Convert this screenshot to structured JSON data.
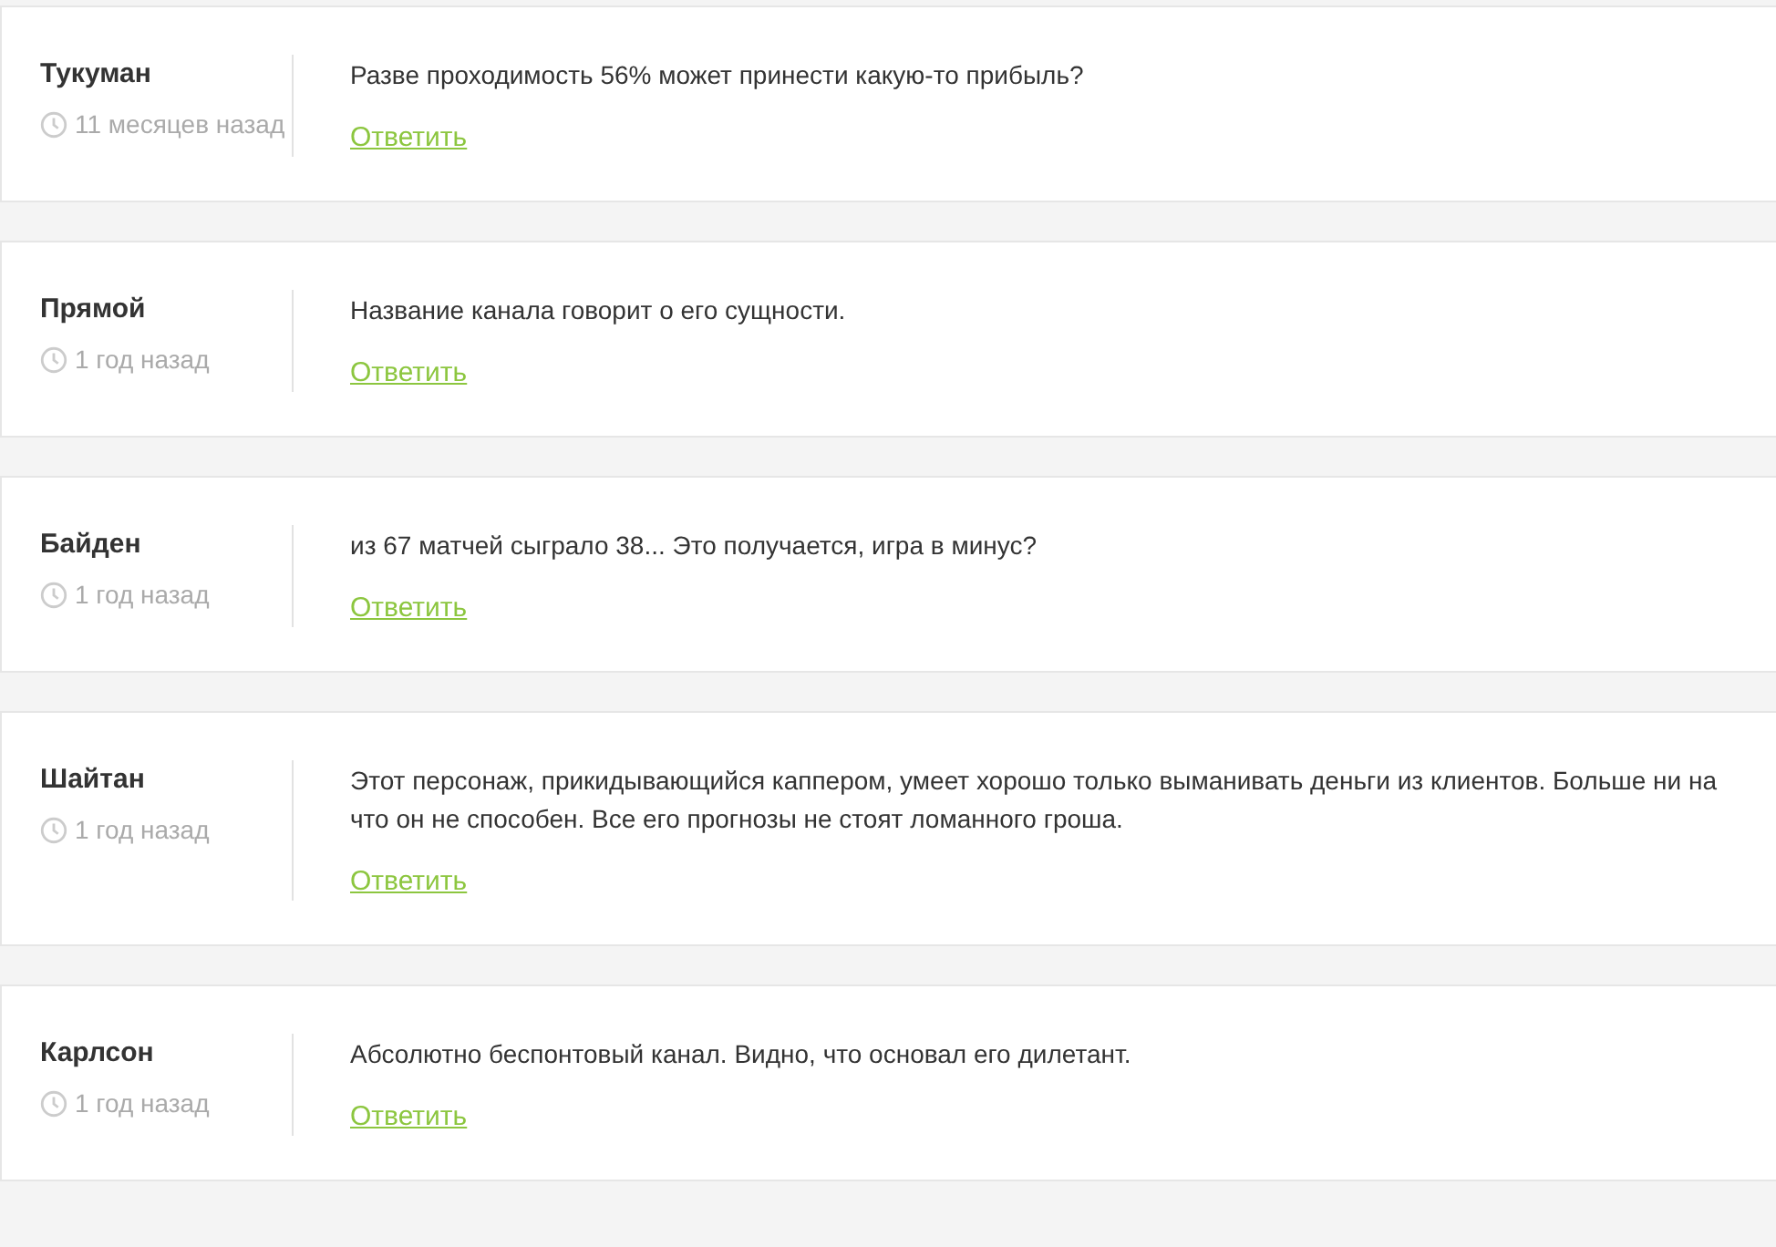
{
  "comments": [
    {
      "author": "Тукуман",
      "time": "11 месяцев назад",
      "text": "Разве проходимость 56% может принести какую-то прибыль?",
      "reply": "Ответить"
    },
    {
      "author": "Прямой",
      "time": "1 год назад",
      "text": "Название канала говорит о его сущности.",
      "reply": "Ответить"
    },
    {
      "author": "Байден",
      "time": "1 год назад",
      "text": "из 67 матчей сыграло 38... Это получается, игра в минус?",
      "reply": "Ответить"
    },
    {
      "author": "Шайтан",
      "time": "1 год назад",
      "text": "Этот персонаж, прикидывающийся каппером, умеет хорошо только выманивать деньги из клиентов. Больше ни на что он не способен. Все его прогнозы не стоят ломанного гроша.",
      "reply": "Ответить"
    },
    {
      "author": "Карлсон",
      "time": "1 год назад",
      "text": "Абсолютно беспонтовый канал. Видно, что основал его дилетант.",
      "reply": "Ответить"
    }
  ]
}
